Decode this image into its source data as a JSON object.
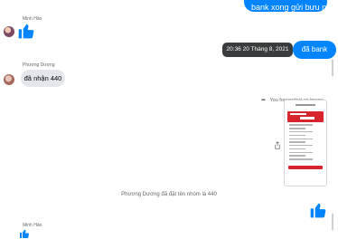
{
  "messages": {
    "top_outgoing": "bank xong gửi bưu nhé",
    "sender_1": "Minh Hảo",
    "tooltip_time": "20:36 20 Tháng 8, 2021",
    "outgoing_1": "đã bank",
    "sender_2": "Phương Dương",
    "incoming_1": "đã nhận 440",
    "forward_note": "You forwarded an image",
    "system_note": "Phương Dương đã đặt tên nhóm là 440",
    "sender_3": "Minh Hảo"
  },
  "colors": {
    "outgoing_bubble": "#0084ff",
    "incoming_bubble": "#e4e6eb",
    "tooltip_bg": "#3a3b3c",
    "receipt_accent": "#d8242c"
  },
  "icons": {
    "like": "like-icon",
    "share": "share-icon",
    "forward": "forward-arrow-icon"
  }
}
